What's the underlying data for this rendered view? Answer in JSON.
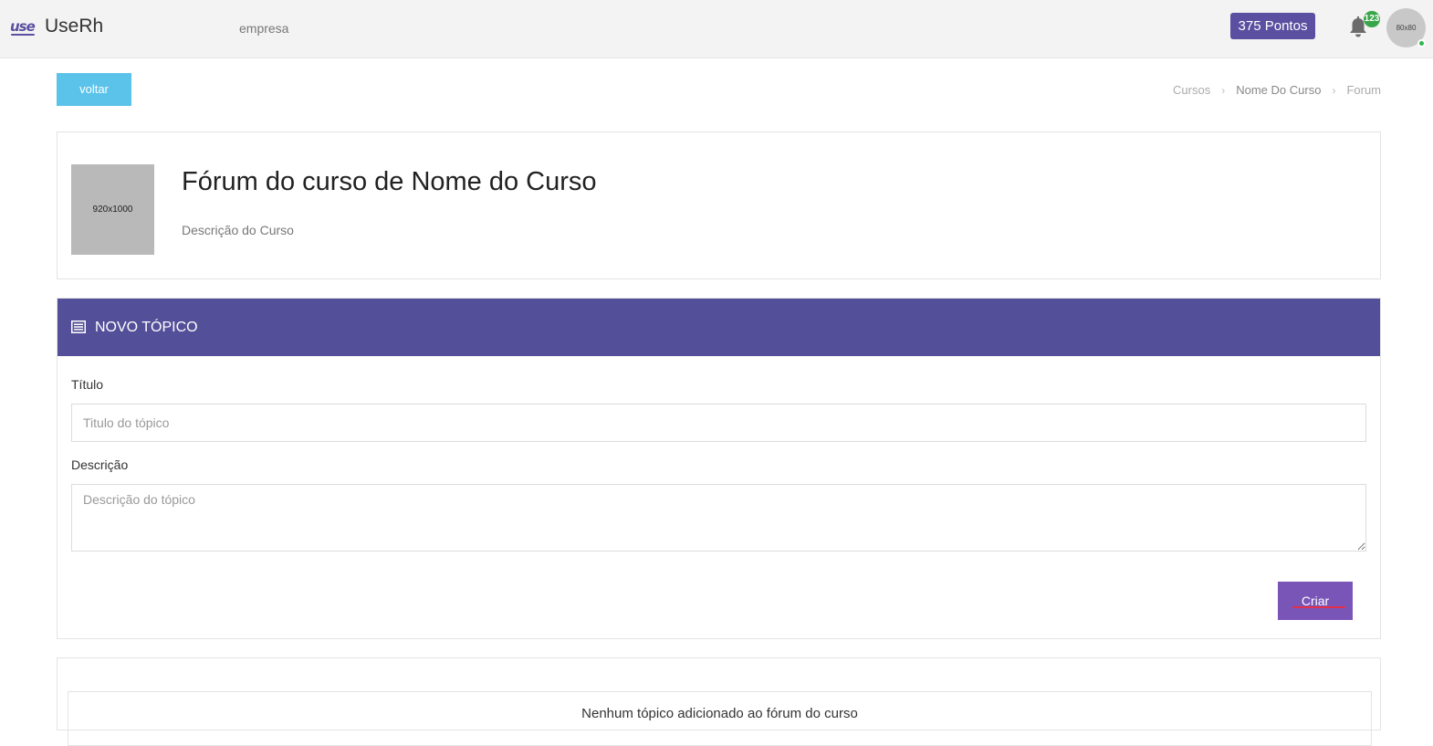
{
  "header": {
    "logo_text": "use",
    "brand": "UseRh",
    "company": "empresa",
    "points": "375 Pontos",
    "notifications_count": "123",
    "avatar_text": "80x80"
  },
  "nav": {
    "back_label": "voltar",
    "breadcrumb": [
      "Cursos",
      "Nome Do Curso",
      "Forum"
    ]
  },
  "course": {
    "image_placeholder": "920x1000",
    "title": "Fórum do curso de Nome do Curso",
    "description": "Descrição do Curso"
  },
  "new_topic": {
    "header_title": "NOVO TÓPICO",
    "title_label": "Título",
    "title_placeholder": "Titulo do tópico",
    "title_value": "",
    "description_label": "Descrição",
    "description_placeholder": "Descrição do tópico",
    "description_value": "",
    "create_label": "Criar"
  },
  "topics": {
    "empty_message": "Nenhum tópico adicionado ao fórum do curso"
  },
  "colors": {
    "primary": "#544f99",
    "back_button": "#5bc3ea",
    "create_button": "#7a55b8",
    "badge": "#3aa64b"
  }
}
